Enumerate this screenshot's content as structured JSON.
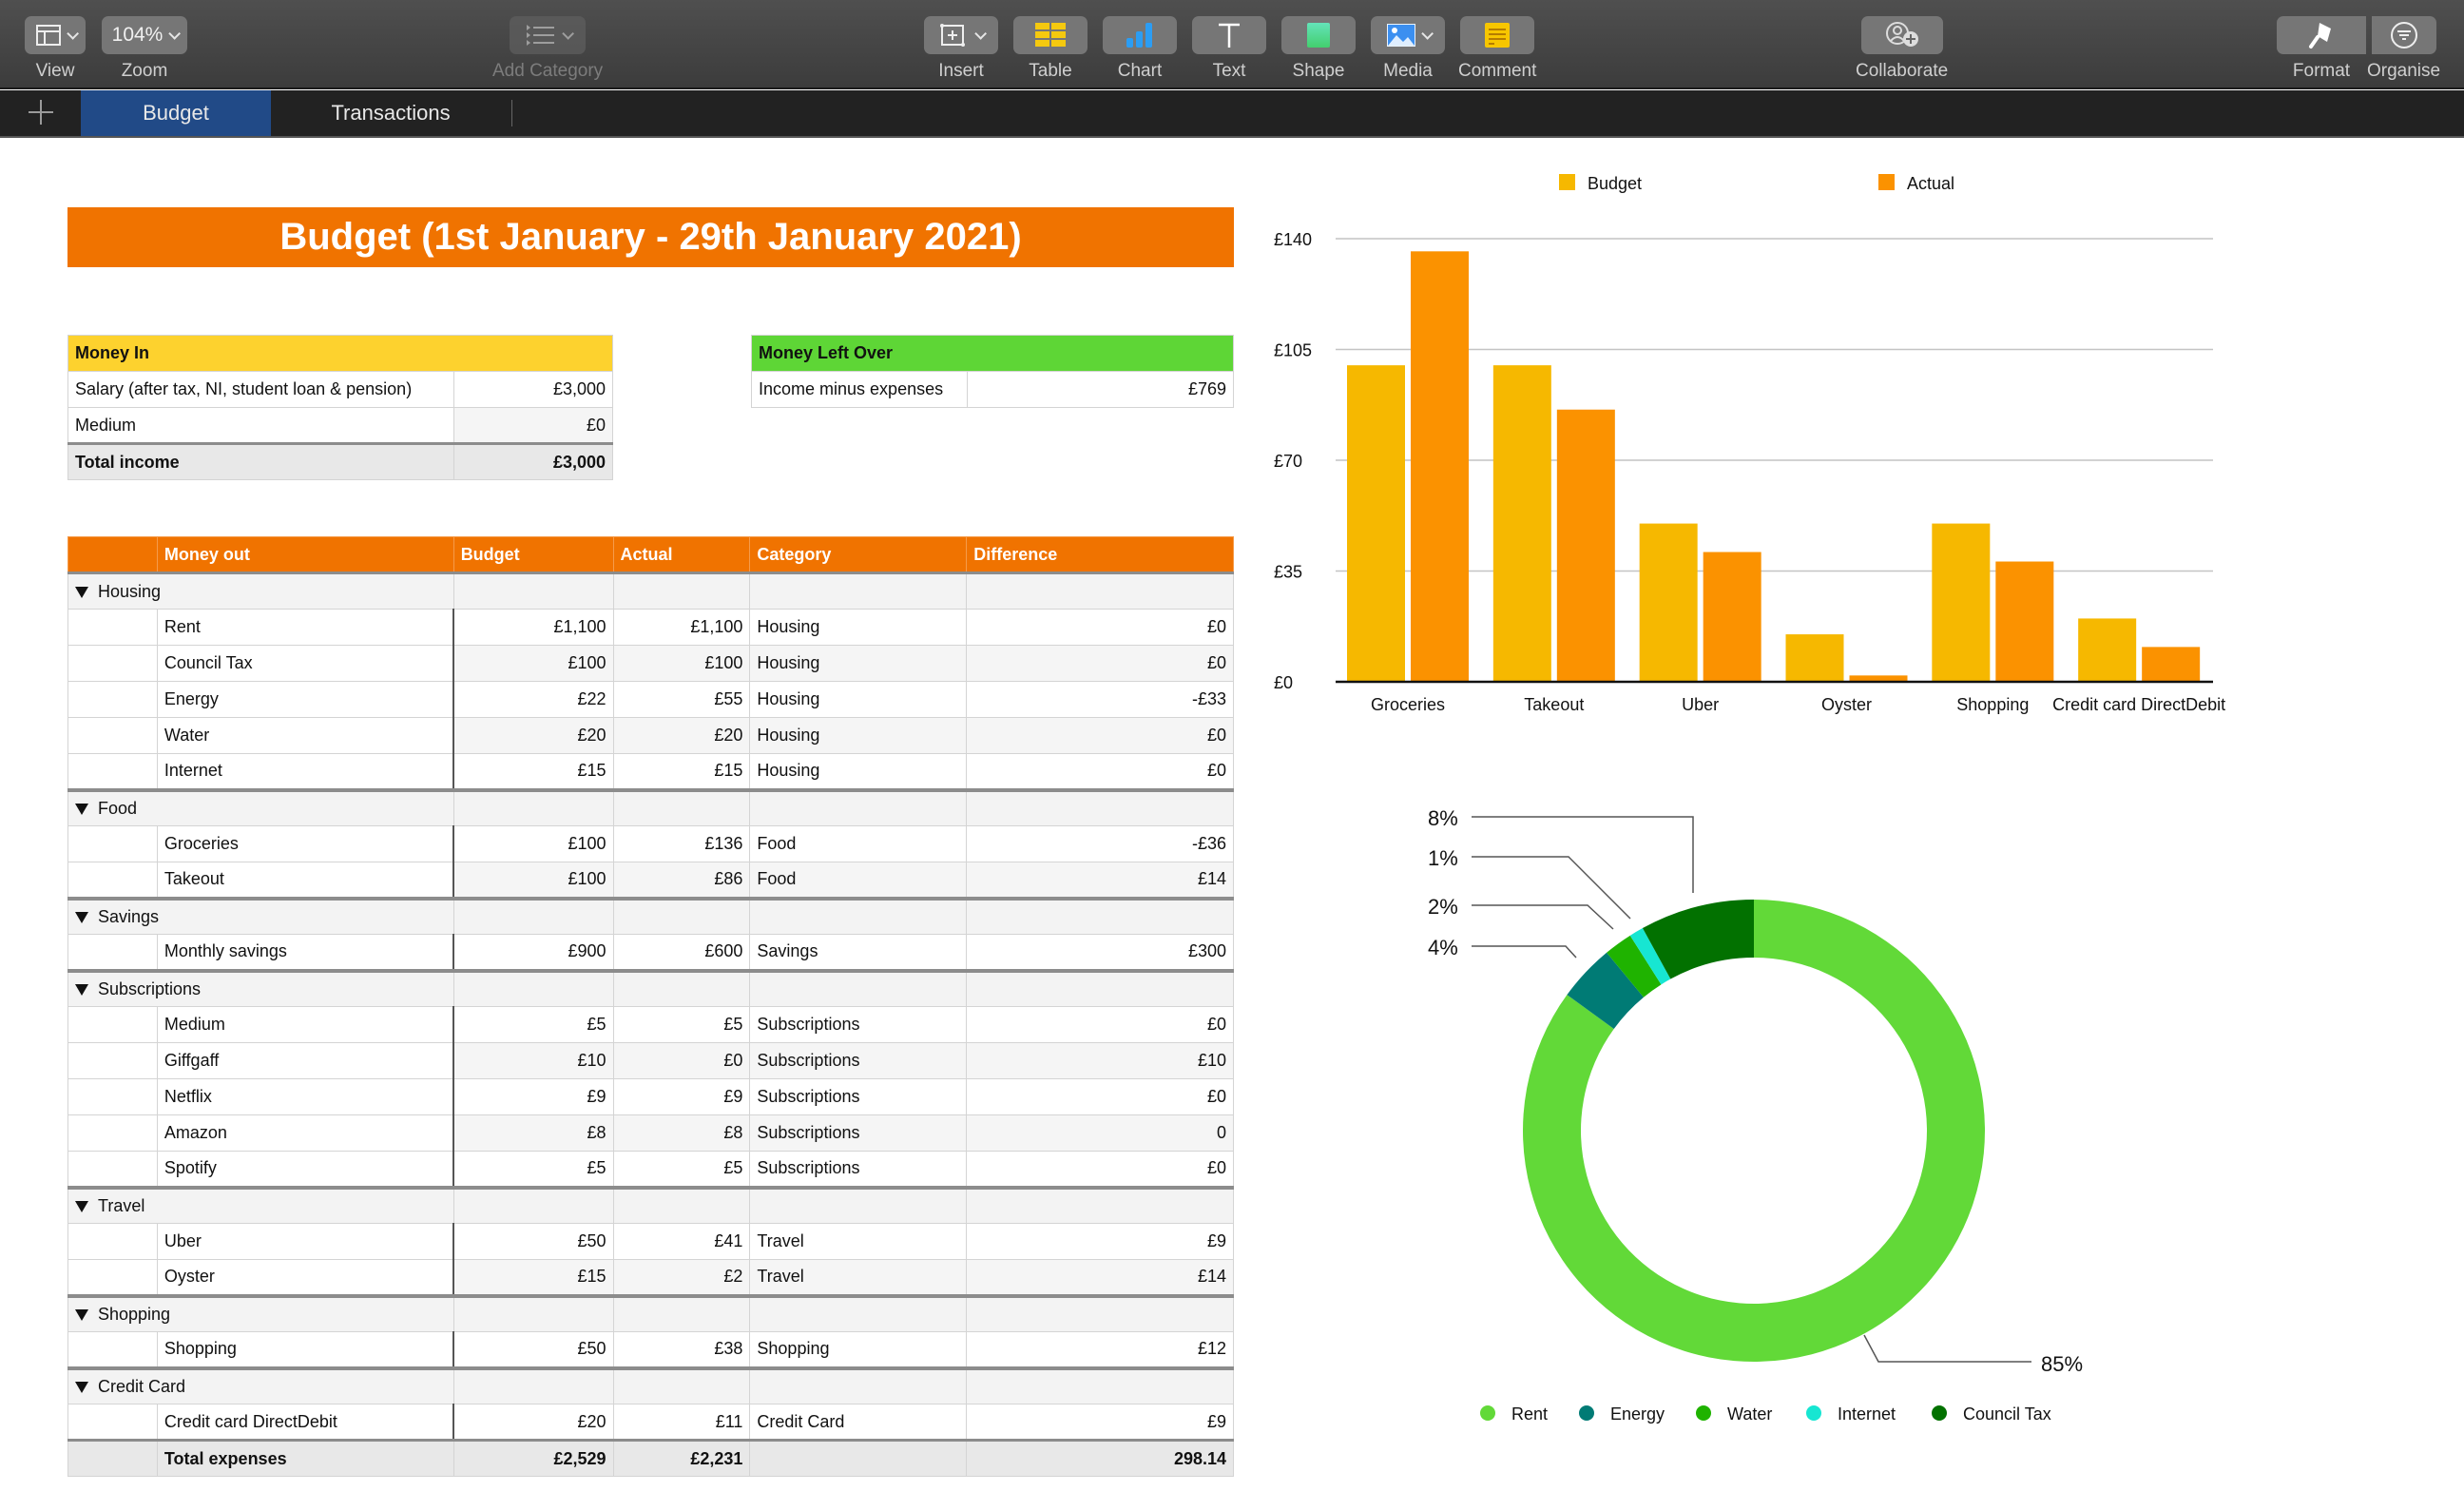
{
  "toolbar": {
    "view": {
      "label": "View",
      "icon": "sidebar-layout-icon"
    },
    "zoom": {
      "label": "Zoom",
      "value": "104%"
    },
    "add_category": {
      "label": "Add Category",
      "icon": "list-category-icon",
      "disabled": true
    },
    "insert": {
      "label": "Insert",
      "icon": "insert-plus-icon"
    },
    "table": {
      "label": "Table",
      "icon": "table-grid-icon"
    },
    "chart": {
      "label": "Chart",
      "icon": "bar-chart-icon"
    },
    "text": {
      "label": "Text",
      "icon": "text-t-icon"
    },
    "shape": {
      "label": "Shape",
      "icon": "shape-rectangle-icon"
    },
    "media": {
      "label": "Media",
      "icon": "image-icon"
    },
    "comment": {
      "label": "Comment",
      "icon": "comment-note-icon"
    },
    "collaborate": {
      "label": "Collaborate",
      "icon": "person-add-icon"
    },
    "format": {
      "label": "Format",
      "icon": "paintbrush-icon"
    },
    "organise": {
      "label": "Organise",
      "icon": "filter-circle-icon"
    }
  },
  "tabs": [
    {
      "label": "Budget",
      "active": true
    },
    {
      "label": "Transactions",
      "active": false
    }
  ],
  "title": "Budget (1st January - 29th January 2021)",
  "money_in": {
    "header": "Money In",
    "rows": [
      {
        "label": "Salary (after tax, NI, student loan & pension)",
        "value": "£3,000"
      },
      {
        "label": "Medium",
        "value": "£0"
      }
    ],
    "total": {
      "label": "Total income",
      "value": "£3,000"
    }
  },
  "money_left": {
    "header": "Money Left Over",
    "rows": [
      {
        "label": "Income minus expenses",
        "value": "£769"
      }
    ]
  },
  "money_out": {
    "columns": [
      "",
      "Money out",
      "Budget",
      "Actual",
      "Category",
      "Difference"
    ],
    "groups": [
      {
        "name": "Housing",
        "items": [
          {
            "name": "Rent",
            "budget": "£1,100",
            "actual": "£1,100",
            "category": "Housing",
            "difference": "£0"
          },
          {
            "name": "Council Tax",
            "budget": "£100",
            "actual": "£100",
            "category": "Housing",
            "difference": "£0"
          },
          {
            "name": "Energy",
            "budget": "£22",
            "actual": "£55",
            "category": "Housing",
            "difference": "-£33"
          },
          {
            "name": "Water",
            "budget": "£20",
            "actual": "£20",
            "category": "Housing",
            "difference": "£0"
          },
          {
            "name": "Internet",
            "budget": "£15",
            "actual": "£15",
            "category": "Housing",
            "difference": "£0"
          }
        ]
      },
      {
        "name": "Food",
        "items": [
          {
            "name": "Groceries",
            "budget": "£100",
            "actual": "£136",
            "category": "Food",
            "difference": "-£36"
          },
          {
            "name": "Takeout",
            "budget": "£100",
            "actual": "£86",
            "category": "Food",
            "difference": "£14"
          }
        ]
      },
      {
        "name": "Savings",
        "items": [
          {
            "name": "Monthly savings",
            "budget": "£900",
            "actual": "£600",
            "category": "Savings",
            "difference": "£300"
          }
        ]
      },
      {
        "name": "Subscriptions",
        "items": [
          {
            "name": "Medium",
            "budget": "£5",
            "actual": "£5",
            "category": "Subscriptions",
            "difference": "£0"
          },
          {
            "name": "Giffgaff",
            "budget": "£10",
            "actual": "£0",
            "category": "Subscriptions",
            "difference": "£10"
          },
          {
            "name": "Netflix",
            "budget": "£9",
            "actual": "£9",
            "category": "Subscriptions",
            "difference": "£0"
          },
          {
            "name": "Amazon",
            "budget": "£8",
            "actual": "£8",
            "category": "Subscriptions",
            "difference": "0"
          },
          {
            "name": "Spotify",
            "budget": "£5",
            "actual": "£5",
            "category": "Subscriptions",
            "difference": "£0"
          }
        ]
      },
      {
        "name": "Travel",
        "items": [
          {
            "name": "Uber",
            "budget": "£50",
            "actual": "£41",
            "category": "Travel",
            "difference": "£9"
          },
          {
            "name": "Oyster",
            "budget": "£15",
            "actual": "£2",
            "category": "Travel",
            "difference": "£14"
          }
        ]
      },
      {
        "name": "Shopping",
        "items": [
          {
            "name": "Shopping",
            "budget": "£50",
            "actual": "£38",
            "category": "Shopping",
            "difference": "£12"
          }
        ]
      },
      {
        "name": "Credit Card",
        "items": [
          {
            "name": "Credit card DirectDebit",
            "budget": "£20",
            "actual": "£11",
            "category": "Credit Card",
            "difference": "£9"
          }
        ]
      }
    ],
    "total": {
      "label": "Total expenses",
      "budget": "£2,529",
      "actual": "£2,231",
      "difference": "298.14"
    }
  },
  "chart_data": [
    {
      "type": "bar",
      "title": "",
      "xlabel": "",
      "ylabel": "",
      "categories": [
        "Groceries",
        "Takeout",
        "Uber",
        "Oyster",
        "Shopping",
        "Credit card DirectDebit"
      ],
      "series": [
        {
          "name": "Budget",
          "color": "#f6b800",
          "values": [
            100,
            100,
            50,
            15,
            50,
            20
          ]
        },
        {
          "name": "Actual",
          "color": "#fb9200",
          "values": [
            136,
            86,
            41,
            2,
            38,
            11
          ]
        }
      ],
      "ylim": [
        0,
        140
      ],
      "yticks": [
        0,
        35,
        70,
        105,
        140
      ],
      "ytick_labels": [
        "£0",
        "£35",
        "£70",
        "£105",
        "£140"
      ],
      "grid": true,
      "legend": "top"
    },
    {
      "type": "pie",
      "variant": "donut",
      "title": "",
      "slices": [
        {
          "label": "Rent",
          "value": 85,
          "display": "85%",
          "color": "#62d938"
        },
        {
          "label": "Energy",
          "value": 4,
          "display": "4%",
          "color": "#007b75"
        },
        {
          "label": "Water",
          "value": 2,
          "display": "2%",
          "color": "#1fb300"
        },
        {
          "label": "Internet",
          "value": 1,
          "display": "1%",
          "color": "#17e6d2"
        },
        {
          "label": "Council Tax",
          "value": 8,
          "display": "8%",
          "color": "#027100"
        }
      ],
      "legend": "bottom"
    }
  ]
}
